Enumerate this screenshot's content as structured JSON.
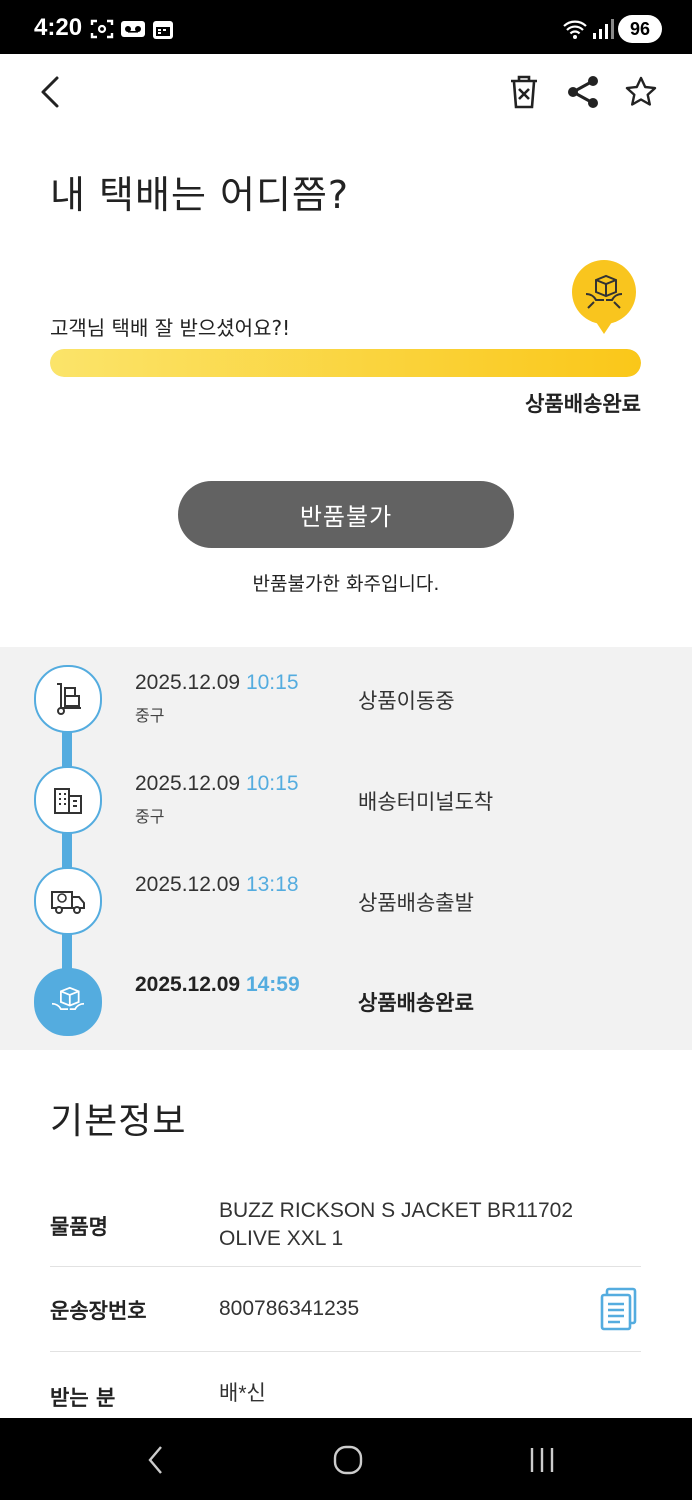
{
  "status_bar": {
    "time": "4:20",
    "battery": "96"
  },
  "page": {
    "title": "내 택배는 어디쯤?"
  },
  "delivery": {
    "message": "고객님 택배 잘 받으셨어요?!",
    "progress_percent": 100,
    "status_label": "상품배송완료",
    "accent_color": "#F9C51E"
  },
  "return_section": {
    "button_label": "반품불가",
    "note": "반품불가한 화주입니다."
  },
  "timeline": [
    {
      "date": "2025.12.09",
      "time": "10:15",
      "place": "중구",
      "status": "상품이동중",
      "icon": "hand-truck-icon"
    },
    {
      "date": "2025.12.09",
      "time": "10:15",
      "place": "중구",
      "status": "배송터미널도착",
      "icon": "building-icon"
    },
    {
      "date": "2025.12.09",
      "time": "13:18",
      "place": "",
      "status": "상품배송출발",
      "icon": "delivery-truck-icon"
    },
    {
      "date": "2025.12.09",
      "time": "14:59",
      "place": "",
      "status": "상품배송완료",
      "icon": "box-in-hands-icon"
    }
  ],
  "basic_info": {
    "title": "기본정보",
    "product_label": "물품명",
    "product_value_line1": "BUZZ RICKSON S  JACKET  BR11702",
    "product_value_line2": "OLIVE  XXL  1",
    "tracking_label": "운송장번호",
    "tracking_value": "800786341235",
    "recipient_label": "받는 분",
    "recipient_value": "배*신"
  },
  "colors": {
    "timeline_accent": "#54ACDF",
    "button_gray": "#626262"
  }
}
